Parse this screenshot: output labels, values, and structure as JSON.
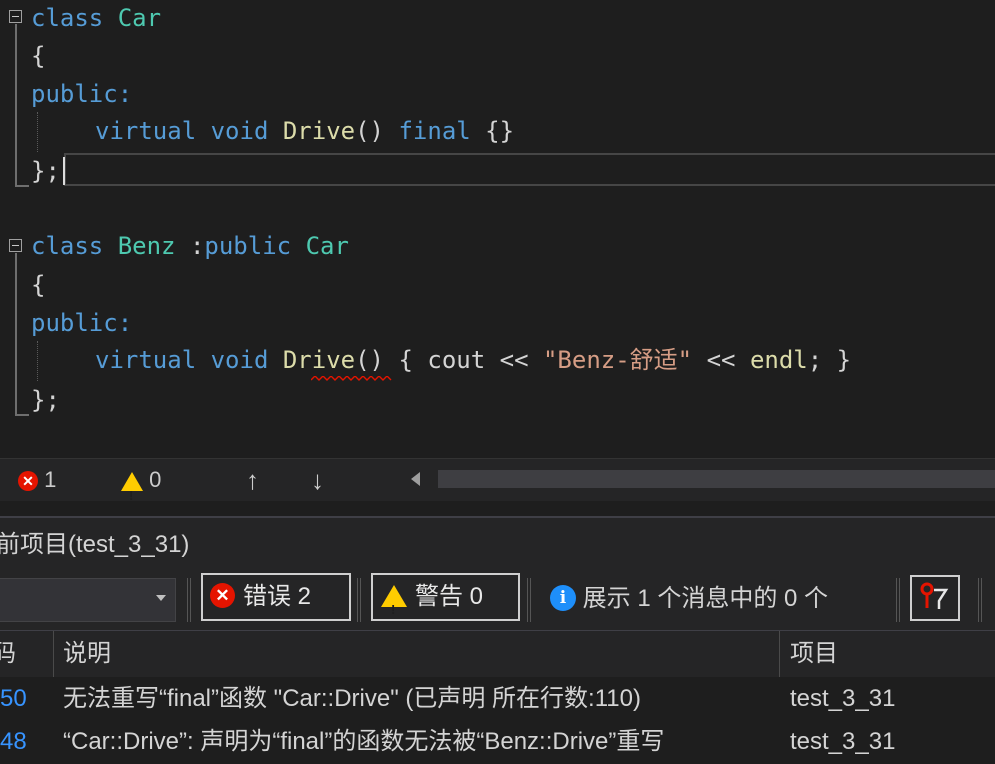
{
  "code": {
    "line1": {
      "kw": "class",
      "name": "Car"
    },
    "line2": "{",
    "line3": "public:",
    "line4": {
      "kw1": "virtual",
      "kw2": "void",
      "fn": "Drive",
      "parens": "()",
      "kw3": "final",
      "body": "{}"
    },
    "line5": "};",
    "line6": {
      "kw": "class",
      "name": "Benz",
      "colon": ":",
      "kw2": "public",
      "base": "Car"
    },
    "line7": "{",
    "line8": "public:",
    "line9": {
      "kw1": "virtual",
      "kw2": "void",
      "fn": "Drive",
      "parens": "()",
      "open": "{",
      "cout": "cout",
      "op1": "<<",
      "str": "\"Benz-舒适\"",
      "op2": "<<",
      "endl": "endl",
      "end": "; }"
    },
    "line10": "};"
  },
  "status_strip": {
    "errors": "1",
    "warnings": "0",
    "up_arrow": "↑",
    "down_arrow": "↓",
    "error_icon": "x-circle-icon",
    "warning_icon": "warning-triangle-icon"
  },
  "error_list": {
    "title": "前项目(test_3_31)",
    "errors_button": "错误 2",
    "warnings_button": "警告 0",
    "messages_text": "展示 1 个消息中的 0 个",
    "columns": {
      "code": "码",
      "description": "说明",
      "project": "项目"
    },
    "rows": [
      {
        "code": "50",
        "description": "无法重写“final”函数 \"Car::Drive\" (已声明 所在行数:110)",
        "project": "test_3_31"
      },
      {
        "code": "48",
        "description": "“Car::Drive”: 声明为“final”的函数无法被“Benz::Drive”重写",
        "project": "test_3_31"
      }
    ]
  },
  "colors": {
    "error": "#e51400",
    "warning": "#ffcc00",
    "info": "#1e8ffa",
    "keyword": "#569cd6",
    "type": "#4ec9b0",
    "function": "#dcdcaa",
    "string": "#d69d85"
  }
}
